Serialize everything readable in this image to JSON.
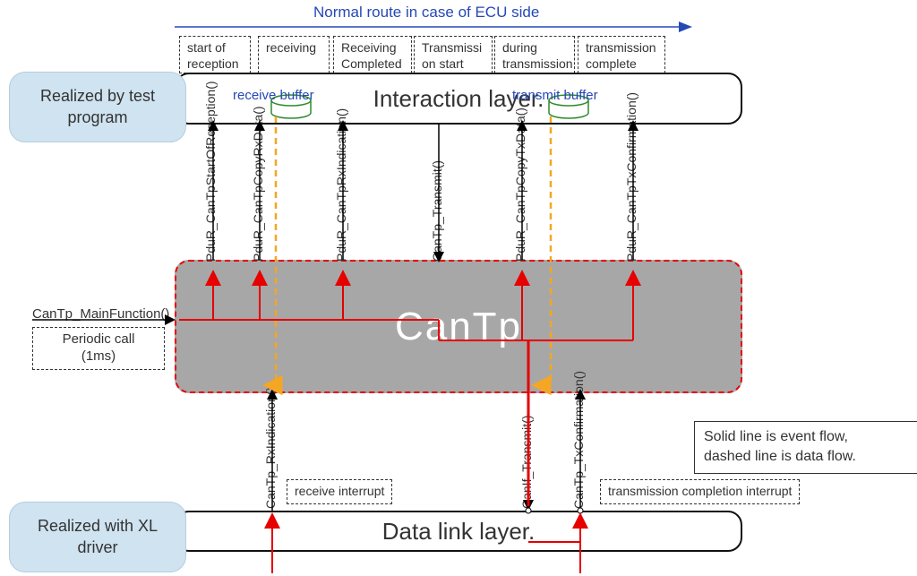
{
  "title": {
    "route": "Normal route in case of ECU side"
  },
  "phases": {
    "p1": "start of\nreception",
    "p2": "receiving",
    "p3": "Receiving\nCompleted",
    "p4": "Transmissi\non start",
    "p5": "during\ntransmission",
    "p6": "transmission\ncomplete"
  },
  "layers": {
    "interaction": "Interaction layer.",
    "cantp": "CanTp",
    "datalink": "Data link layer."
  },
  "bubbles": {
    "test_program": "Realized by test\nprogram",
    "xl_driver": "Realized with XL\ndriver"
  },
  "side_labels": {
    "mainfunc": "CanTp_MainFunction()",
    "periodic": "Periodic call\n(1ms)"
  },
  "buffers": {
    "rx": "receive buffer",
    "tx": "transmit buffer"
  },
  "interrupts": {
    "rx": "receive interrupt",
    "tx": "transmission completion interrupt"
  },
  "legend": {
    "text": "Solid line is event flow,\ndashed line is data flow."
  },
  "api": {
    "start_of_rx": "PduR_CanTpStartOfReception()",
    "copy_rx": "PduR_CanTpCopyRxData()",
    "rx_ind_up": "PduR_CanTpRxIndication()",
    "tx_transmit": "CanTp_Transmit()",
    "copy_tx": "PduR_CanTpCopyTxData()",
    "tx_conf_up": "PduR_CanTpTxConfirmation()",
    "rx_ind_low": "CanTp_RxIndication()",
    "if_transmit": "CanIf_Transmit()",
    "tx_conf_low": "CanTp_TxConfirmation()"
  }
}
